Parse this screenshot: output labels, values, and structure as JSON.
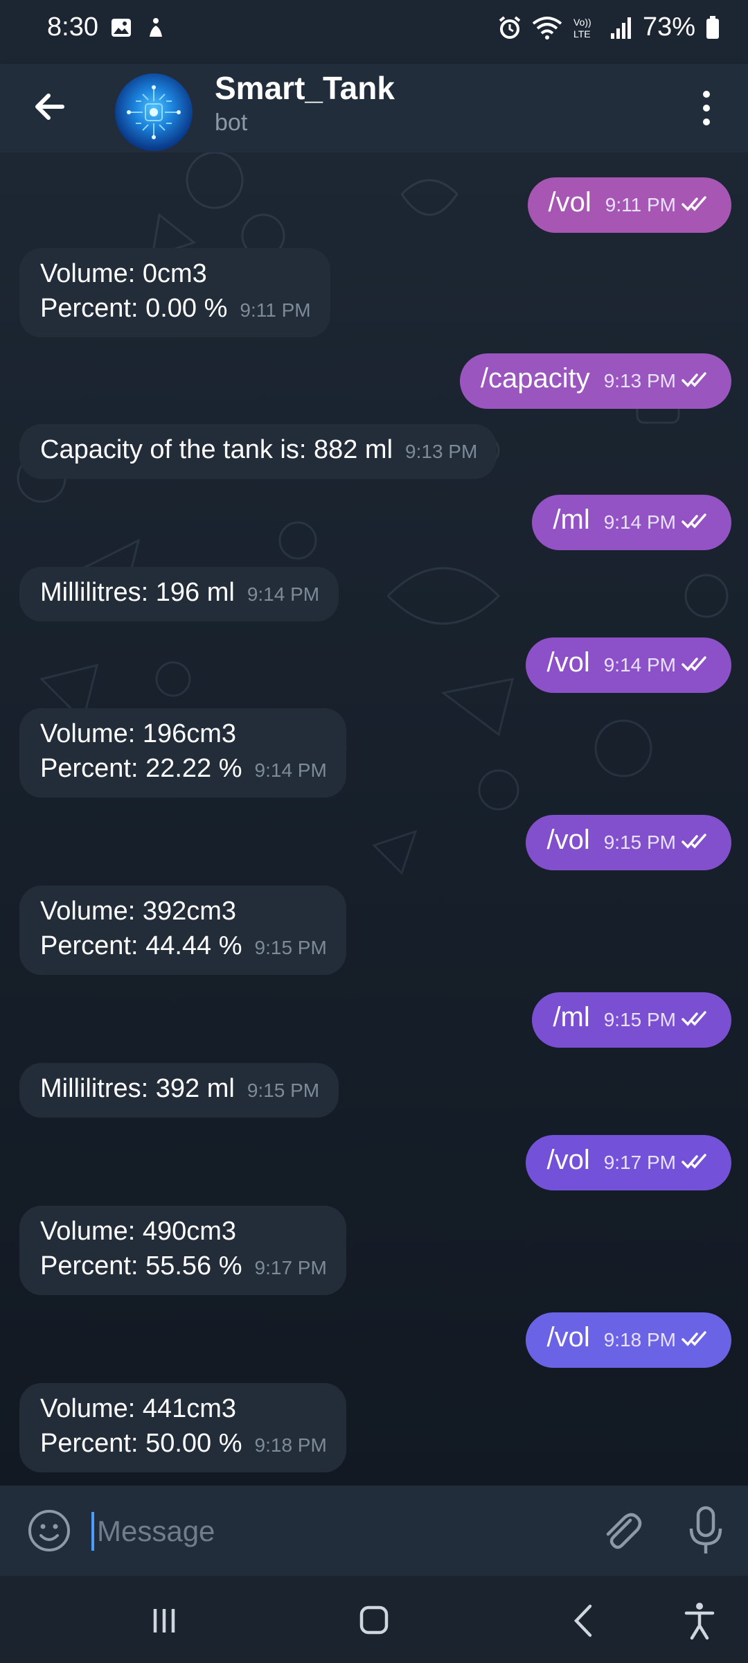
{
  "status_bar": {
    "time": "8:30",
    "battery": "73%",
    "icons": [
      "gallery-icon",
      "accessibility-status-icon",
      "alarm-icon",
      "wifi-icon",
      "volte-icon",
      "signal-icon",
      "battery-icon"
    ]
  },
  "header": {
    "title": "Smart_Tank",
    "subtitle": "bot"
  },
  "messages": [
    {
      "dir": "out",
      "text": "/vol",
      "time": "9:11 PM"
    },
    {
      "dir": "in",
      "lines": [
        "Volume: 0cm3",
        "Percent: 0.00 %"
      ],
      "time": "9:11 PM"
    },
    {
      "dir": "out",
      "text": "/capacity",
      "time": "9:13 PM"
    },
    {
      "dir": "in",
      "lines": [
        "Capacity of the tank is: 882 ml"
      ],
      "time": "9:13 PM"
    },
    {
      "dir": "out",
      "text": "/ml",
      "time": "9:14 PM"
    },
    {
      "dir": "in",
      "lines": [
        "Millilitres: 196 ml"
      ],
      "time": "9:14 PM"
    },
    {
      "dir": "out",
      "text": "/vol",
      "time": "9:14 PM"
    },
    {
      "dir": "in",
      "lines": [
        "Volume: 196cm3",
        "Percent: 22.22 %"
      ],
      "time": "9:14 PM"
    },
    {
      "dir": "out",
      "text": "/vol",
      "time": "9:15 PM"
    },
    {
      "dir": "in",
      "lines": [
        "Volume: 392cm3",
        "Percent: 44.44 %"
      ],
      "time": "9:15 PM"
    },
    {
      "dir": "out",
      "text": "/ml",
      "time": "9:15 PM"
    },
    {
      "dir": "in",
      "lines": [
        "Millilitres: 392 ml"
      ],
      "time": "9:15 PM"
    },
    {
      "dir": "out",
      "text": "/vol",
      "time": "9:17 PM"
    },
    {
      "dir": "in",
      "lines": [
        "Volume: 490cm3",
        "Percent: 55.56 %"
      ],
      "time": "9:17 PM"
    },
    {
      "dir": "out",
      "text": "/vol",
      "time": "9:18 PM"
    },
    {
      "dir": "in",
      "lines": [
        "Volume: 441cm3",
        "Percent: 50.00 %"
      ],
      "time": "9:18 PM"
    }
  ],
  "composer": {
    "placeholder": "Message"
  },
  "colors": {
    "outgoing_top": "#a255b8",
    "outgoing_mid": "#7a4fd6",
    "outgoing_bottom": "#6a66e8",
    "incoming": "#222d39",
    "header": "#212d3b"
  }
}
